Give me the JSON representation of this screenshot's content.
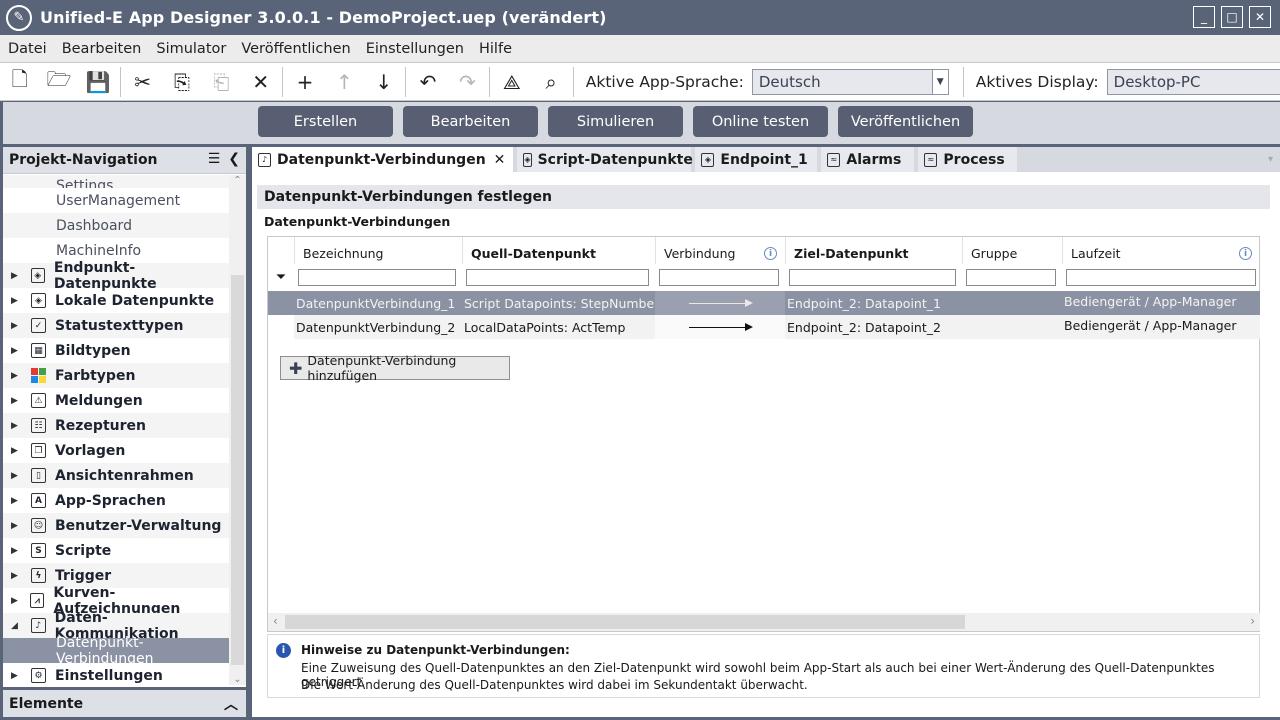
{
  "window": {
    "title": "Unified-E App Designer 3.0.0.1 - DemoProject.uep  (verändert)"
  },
  "menu": [
    "Datei",
    "Bearbeiten",
    "Simulator",
    "Veröffentlichen",
    "Einstellungen",
    "Hilfe"
  ],
  "toolbar": {
    "language_label": "Aktive App-Sprache:",
    "language_value": "Deutsch",
    "display_label": "Aktives Display:",
    "display_value": "Desktop-PC"
  },
  "actions": [
    "Erstellen",
    "Bearbeiten",
    "Simulieren",
    "Online testen",
    "Veröffentlichen"
  ],
  "nav": {
    "title": "Projekt-Navigation",
    "footer": "Elemente",
    "sub_items": [
      "Settings",
      "UserManagement",
      "Dashboard",
      "MachineInfo"
    ],
    "items": [
      "Endpunkt-Datenpunkte",
      "Lokale Datenpunkte",
      "Statustexttypen",
      "Bildtypen",
      "Farbtypen",
      "Meldungen",
      "Rezepturen",
      "Vorlagen",
      "Ansichtenrahmen",
      "App-Sprachen",
      "Benutzer-Verwaltung",
      "Scripte",
      "Trigger",
      "Kurven-Aufzeichnungen",
      "Daten-Kommunikation",
      "Datenpunkt-Verbindungen",
      "Einstellungen"
    ]
  },
  "tabs": [
    "Datenpunkt-Verbindungen",
    "Script-Datenpunkte",
    "Endpoint_1",
    "Alarms",
    "Process"
  ],
  "content": {
    "section_title": "Datenpunkt-Verbindungen festlegen",
    "group_label": "Datenpunkt-Verbindungen",
    "columns": [
      "Bezeichnung",
      "Quell-Datenpunkt",
      "Verbindung",
      "Ziel-Datenpunkt",
      "Gruppe",
      "Laufzeit"
    ],
    "rows": [
      {
        "name": "DatenpunktVerbindung_1",
        "source": "Script Datapoints: StepNumber",
        "target": "Endpoint_2: Datapoint_1",
        "group": "",
        "runtime": "Bediengerät / App-Manager"
      },
      {
        "name": "DatenpunktVerbindung_2",
        "source": "LocalDataPoints: ActTemp",
        "target": "Endpoint_2: Datapoint_2",
        "group": "",
        "runtime": "Bediengerät / App-Manager"
      }
    ],
    "add_button": "Datenpunkt-Verbindung hinzufügen",
    "notes": {
      "title": "Hinweise zu Datenpunkt-Verbindungen:",
      "line1": "Eine Zuweisung des Quell-Datenpunktes an den Ziel-Datenpunkt wird sowohl beim App-Start als auch bei einer Wert-Änderung des Quell-Datenpunktes getriggert.",
      "line2": "Die Wert-Änderung des Quell-Datenpunktes wird dabei im Sekundentakt überwacht."
    }
  }
}
